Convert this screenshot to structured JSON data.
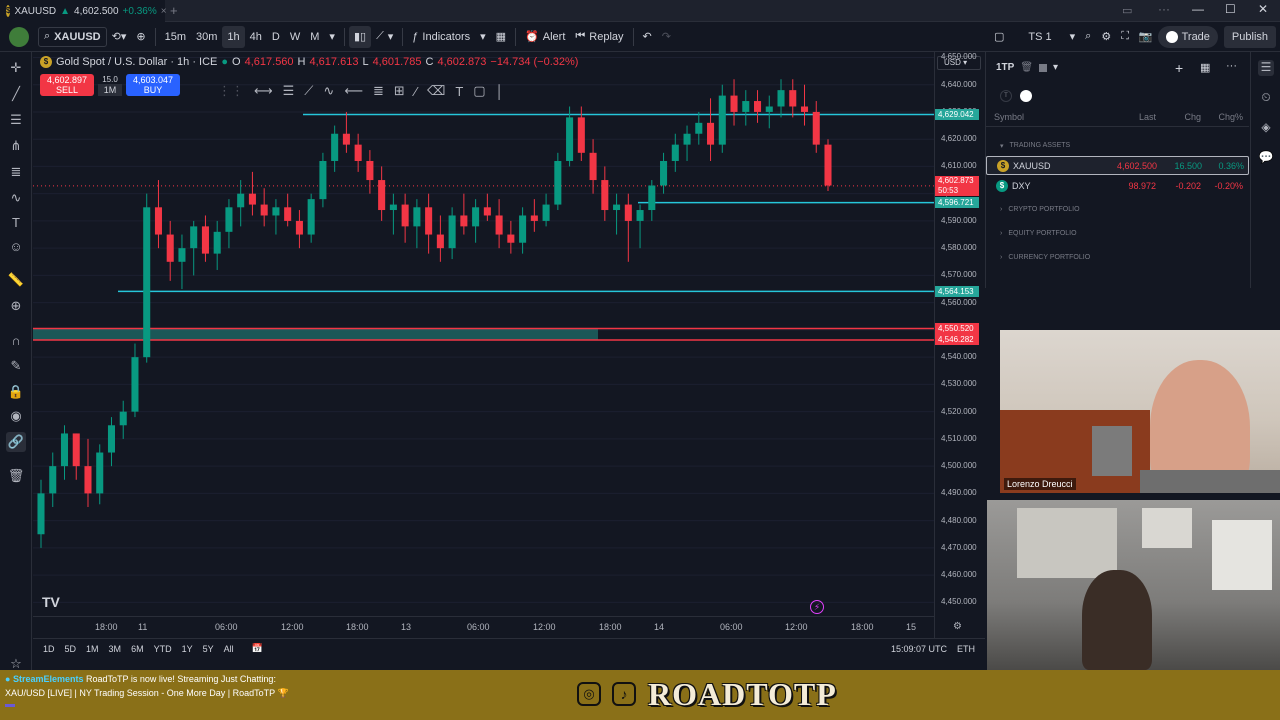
{
  "tab": {
    "symbol": "XAUUSD",
    "price": "4,602.500",
    "change": "+0.36%",
    "close": "×",
    "new_tab": "+"
  },
  "toolbar": {
    "symbol": "XAUUSD",
    "timeframes": [
      "15m",
      "30m",
      "1h",
      "4h",
      "D",
      "W",
      "M"
    ],
    "active_timeframe": "1h",
    "indicators": "Indicators",
    "alert": "Alert",
    "replay": "Replay",
    "layout": "TS 1",
    "trade": "Trade",
    "publish": "Publish"
  },
  "legend": {
    "title": "Gold Spot / U.S. Dollar · 1h · ICE",
    "o_label": "O",
    "o": "4,617.560",
    "h_label": "H",
    "h": "4,617.613",
    "l_label": "L",
    "l": "4,601.785",
    "c_label": "C",
    "c": "4,602.873",
    "chg": "−14.734 (−0.32%)"
  },
  "order": {
    "sell_price": "4,602.897",
    "sell": "SELL",
    "spread": "15.0",
    "qty": "1M",
    "buy_price": "4,603.047",
    "buy": "BUY"
  },
  "currency": "USD",
  "price_axis": [
    "4,650.000",
    "4,640.000",
    "4,630.000",
    "4,620.000",
    "4,610.000",
    "4,600.000",
    "4,590.000",
    "4,580.000",
    "4,570.000",
    "4,560.000",
    "4,550.000",
    "4,540.000",
    "4,530.000",
    "4,520.000",
    "4,510.000",
    "4,500.000",
    "4,490.000",
    "4,480.000",
    "4,470.000",
    "4,460.000",
    "4,450.000"
  ],
  "price_tags": {
    "line1": "4,629.042",
    "current": "4,602.873",
    "countdown": "50:53",
    "line2": "4,596.721",
    "line3": "4,564.153",
    "zone_top": "4,550.520",
    "zone_bottom": "4,546.282"
  },
  "time_axis": [
    "18:00",
    "11",
    "06:00",
    "12:00",
    "18:00",
    "13",
    "06:00",
    "12:00",
    "18:00",
    "14",
    "06:00",
    "12:00",
    "18:00",
    "15"
  ],
  "bottom": {
    "ranges": [
      "1D",
      "5D",
      "1M",
      "3M",
      "6M",
      "YTD",
      "1Y",
      "5Y",
      "All"
    ],
    "clock": "15:09:07 UTC",
    "session": "ETH"
  },
  "watchlist": {
    "name": "1TP",
    "columns": [
      "Symbol",
      "Last",
      "Chg",
      "Chg%"
    ],
    "section_title": "TRADING ASSETS",
    "rows": [
      {
        "symbol": "XAUUSD",
        "last": "4,602.500",
        "chg": "16.500",
        "chgp": "0.36%"
      },
      {
        "symbol": "DXY",
        "last": "98.972",
        "chg": "-0.202",
        "chgp": "-0.20%"
      }
    ],
    "groups": [
      "CRYPTO PORTFOLIO",
      "EQUITY PORTFOLIO",
      "CURRENCY PORTFOLIO"
    ]
  },
  "webcam": {
    "name": "Lorenzo Dreucci"
  },
  "stream": {
    "source": "StreamElements",
    "message": "RoadToTP is now live! Streaming Just Chatting:",
    "title": "XAU/USD [LIVE] | NY Trading Session - One More Day | RoadToTP",
    "brand": "ROADTOTP"
  },
  "colors": {
    "up": "#089981",
    "down": "#f23645",
    "accent": "#2962ff",
    "line": "#26c6da"
  },
  "chart_data": {
    "type": "candlestick",
    "ylim": [
      4445,
      4652
    ],
    "yticks": [
      4650,
      4640,
      4630,
      4620,
      4610,
      4600,
      4590,
      4580,
      4570,
      4560,
      4550,
      4540,
      4530,
      4520,
      4510,
      4500,
      4490,
      4480,
      4470,
      4460,
      4450
    ],
    "hlines": [
      4629.042,
      4596.721,
      4564.153
    ],
    "current": 4602.873,
    "zone": [
      4546.282,
      4550.52
    ],
    "candles": [
      [
        4475,
        4495,
        4470,
        4490
      ],
      [
        4490,
        4505,
        4485,
        4500
      ],
      [
        4500,
        4515,
        4495,
        4512
      ],
      [
        4512,
        4512,
        4495,
        4500
      ],
      [
        4500,
        4510,
        4485,
        4490
      ],
      [
        4490,
        4508,
        4486,
        4505
      ],
      [
        4505,
        4518,
        4500,
        4515
      ],
      [
        4515,
        4524,
        4510,
        4520
      ],
      [
        4520,
        4545,
        4518,
        4540
      ],
      [
        4540,
        4600,
        4538,
        4595
      ],
      [
        4595,
        4605,
        4580,
        4585
      ],
      [
        4585,
        4590,
        4568,
        4575
      ],
      [
        4575,
        4585,
        4565,
        4580
      ],
      [
        4580,
        4590,
        4570,
        4588
      ],
      [
        4588,
        4592,
        4575,
        4578
      ],
      [
        4578,
        4590,
        4572,
        4586
      ],
      [
        4586,
        4598,
        4580,
        4595
      ],
      [
        4595,
        4605,
        4588,
        4600
      ],
      [
        4600,
        4608,
        4592,
        4596
      ],
      [
        4596,
        4602,
        4588,
        4592
      ],
      [
        4592,
        4598,
        4585,
        4595
      ],
      [
        4595,
        4600,
        4588,
        4590
      ],
      [
        4590,
        4594,
        4580,
        4585
      ],
      [
        4585,
        4600,
        4582,
        4598
      ],
      [
        4598,
        4615,
        4595,
        4612
      ],
      [
        4612,
        4625,
        4608,
        4622
      ],
      [
        4622,
        4630,
        4615,
        4618
      ],
      [
        4618,
        4622,
        4608,
        4612
      ],
      [
        4612,
        4616,
        4600,
        4605
      ],
      [
        4605,
        4610,
        4590,
        4594
      ],
      [
        4594,
        4600,
        4585,
        4596
      ],
      [
        4596,
        4600,
        4582,
        4588
      ],
      [
        4588,
        4598,
        4580,
        4595
      ],
      [
        4595,
        4600,
        4578,
        4585
      ],
      [
        4585,
        4592,
        4575,
        4580
      ],
      [
        4580,
        4595,
        4576,
        4592
      ],
      [
        4592,
        4600,
        4585,
        4588
      ],
      [
        4588,
        4598,
        4582,
        4595
      ],
      [
        4595,
        4600,
        4590,
        4592
      ],
      [
        4592,
        4598,
        4580,
        4585
      ],
      [
        4585,
        4590,
        4578,
        4582
      ],
      [
        4582,
        4595,
        4578,
        4592
      ],
      [
        4592,
        4598,
        4586,
        4590
      ],
      [
        4590,
        4600,
        4588,
        4596
      ],
      [
        4596,
        4615,
        4594,
        4612
      ],
      [
        4612,
        4632,
        4610,
        4628
      ],
      [
        4628,
        4632,
        4612,
        4615
      ],
      [
        4615,
        4620,
        4600,
        4605
      ],
      [
        4605,
        4610,
        4590,
        4594
      ],
      [
        4594,
        4600,
        4585,
        4596
      ],
      [
        4596,
        4600,
        4575,
        4590
      ],
      [
        4590,
        4596,
        4580,
        4594
      ],
      [
        4594,
        4605,
        4590,
        4603
      ],
      [
        4603,
        4615,
        4600,
        4612
      ],
      [
        4612,
        4622,
        4608,
        4618
      ],
      [
        4618,
        4625,
        4612,
        4622
      ],
      [
        4622,
        4630,
        4618,
        4626
      ],
      [
        4626,
        4635,
        4612,
        4618
      ],
      [
        4618,
        4640,
        4615,
        4636
      ],
      [
        4636,
        4642,
        4625,
        4630
      ],
      [
        4630,
        4638,
        4625,
        4634
      ],
      [
        4634,
        4638,
        4626,
        4630
      ],
      [
        4630,
        4636,
        4624,
        4632
      ],
      [
        4632,
        4642,
        4628,
        4638
      ],
      [
        4638,
        4642,
        4628,
        4632
      ],
      [
        4632,
        4640,
        4625,
        4630
      ],
      [
        4630,
        4634,
        4615,
        4618
      ],
      [
        4618,
        4620,
        4601,
        4603
      ]
    ]
  }
}
